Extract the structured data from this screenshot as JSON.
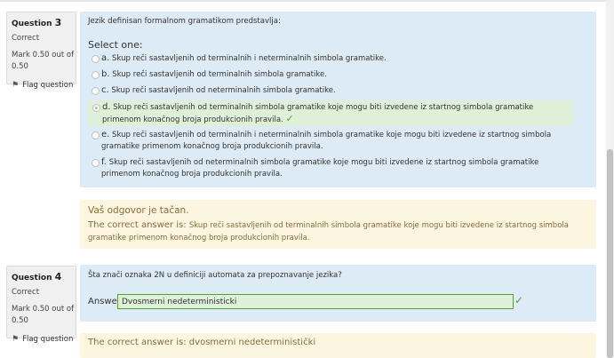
{
  "colors": {
    "formulation_bg": "#dcebf6",
    "feedback_bg": "#fcf6e1",
    "correct_bg": "#dff0d8",
    "check_green": "#5aa02c",
    "feedback_text": "#8a6d3b"
  },
  "q3": {
    "label": "Question",
    "number": "3",
    "state": "Correct",
    "grade_line1": "Mark 0.50 out of",
    "grade_line2": "0.50",
    "flag_label": "Flag question",
    "text": "Jezik definisan formalnom gramatikom predstavlja:",
    "prompt": "Select one:",
    "options": [
      {
        "letter": "a.",
        "text": "Skup reči sastavljenih od terminalnih i neterminalnih simbola gramatike."
      },
      {
        "letter": "b.",
        "text": "Skup reči sastavljenih od terminalnih simbola gramatike."
      },
      {
        "letter": "c.",
        "text": "Skup reči sastavljenih od neterminalnih simbola gramatike."
      },
      {
        "letter": "d.",
        "text": "Skup reči sastavljenih od terminalnih simbola gramatike koje mogu biti izvedene iz startnog simbola gramatike primenom konačnog broja produkcionih pravila."
      },
      {
        "letter": "e.",
        "text": "Skup reči sastavljenih od terminalnih i neterminalnih simbola gramatike koje mogu biti izvedene iz startnog simbola gramatike primenom konačnog broja produkcionih pravila."
      },
      {
        "letter": "f.",
        "text": "Skup reči sastavljenih od neterminalnih simbola gramatike koje mogu biti izvedene iz startnog simbola gramatike primenom konačnog broja produkcionih pravila."
      }
    ],
    "selected_option": "d.",
    "feedback_title": "Vaš odgovor je tačan.",
    "correct_prefix": "The correct answer is:",
    "correct_text": "Skup reči sastavljenih od terminalnih simbola gramatike koje mogu biti izvedene iz startnog simbola gramatike primenom konačnog broja produkcionih pravila."
  },
  "q4": {
    "label": "Question",
    "number": "4",
    "state": "Correct",
    "grade_line1": "Mark 0.50 out of",
    "grade_line2": "0.50",
    "flag_label": "Flag question",
    "text": "Šta znači oznaka 2N u definiciji automata za prepoznavanje jezika?",
    "answer_label": "Answer:",
    "answer_value": "Dvosmerni nedeterministicki",
    "correct_answer": "The correct answer is: dvosmerni nedeterministički"
  }
}
